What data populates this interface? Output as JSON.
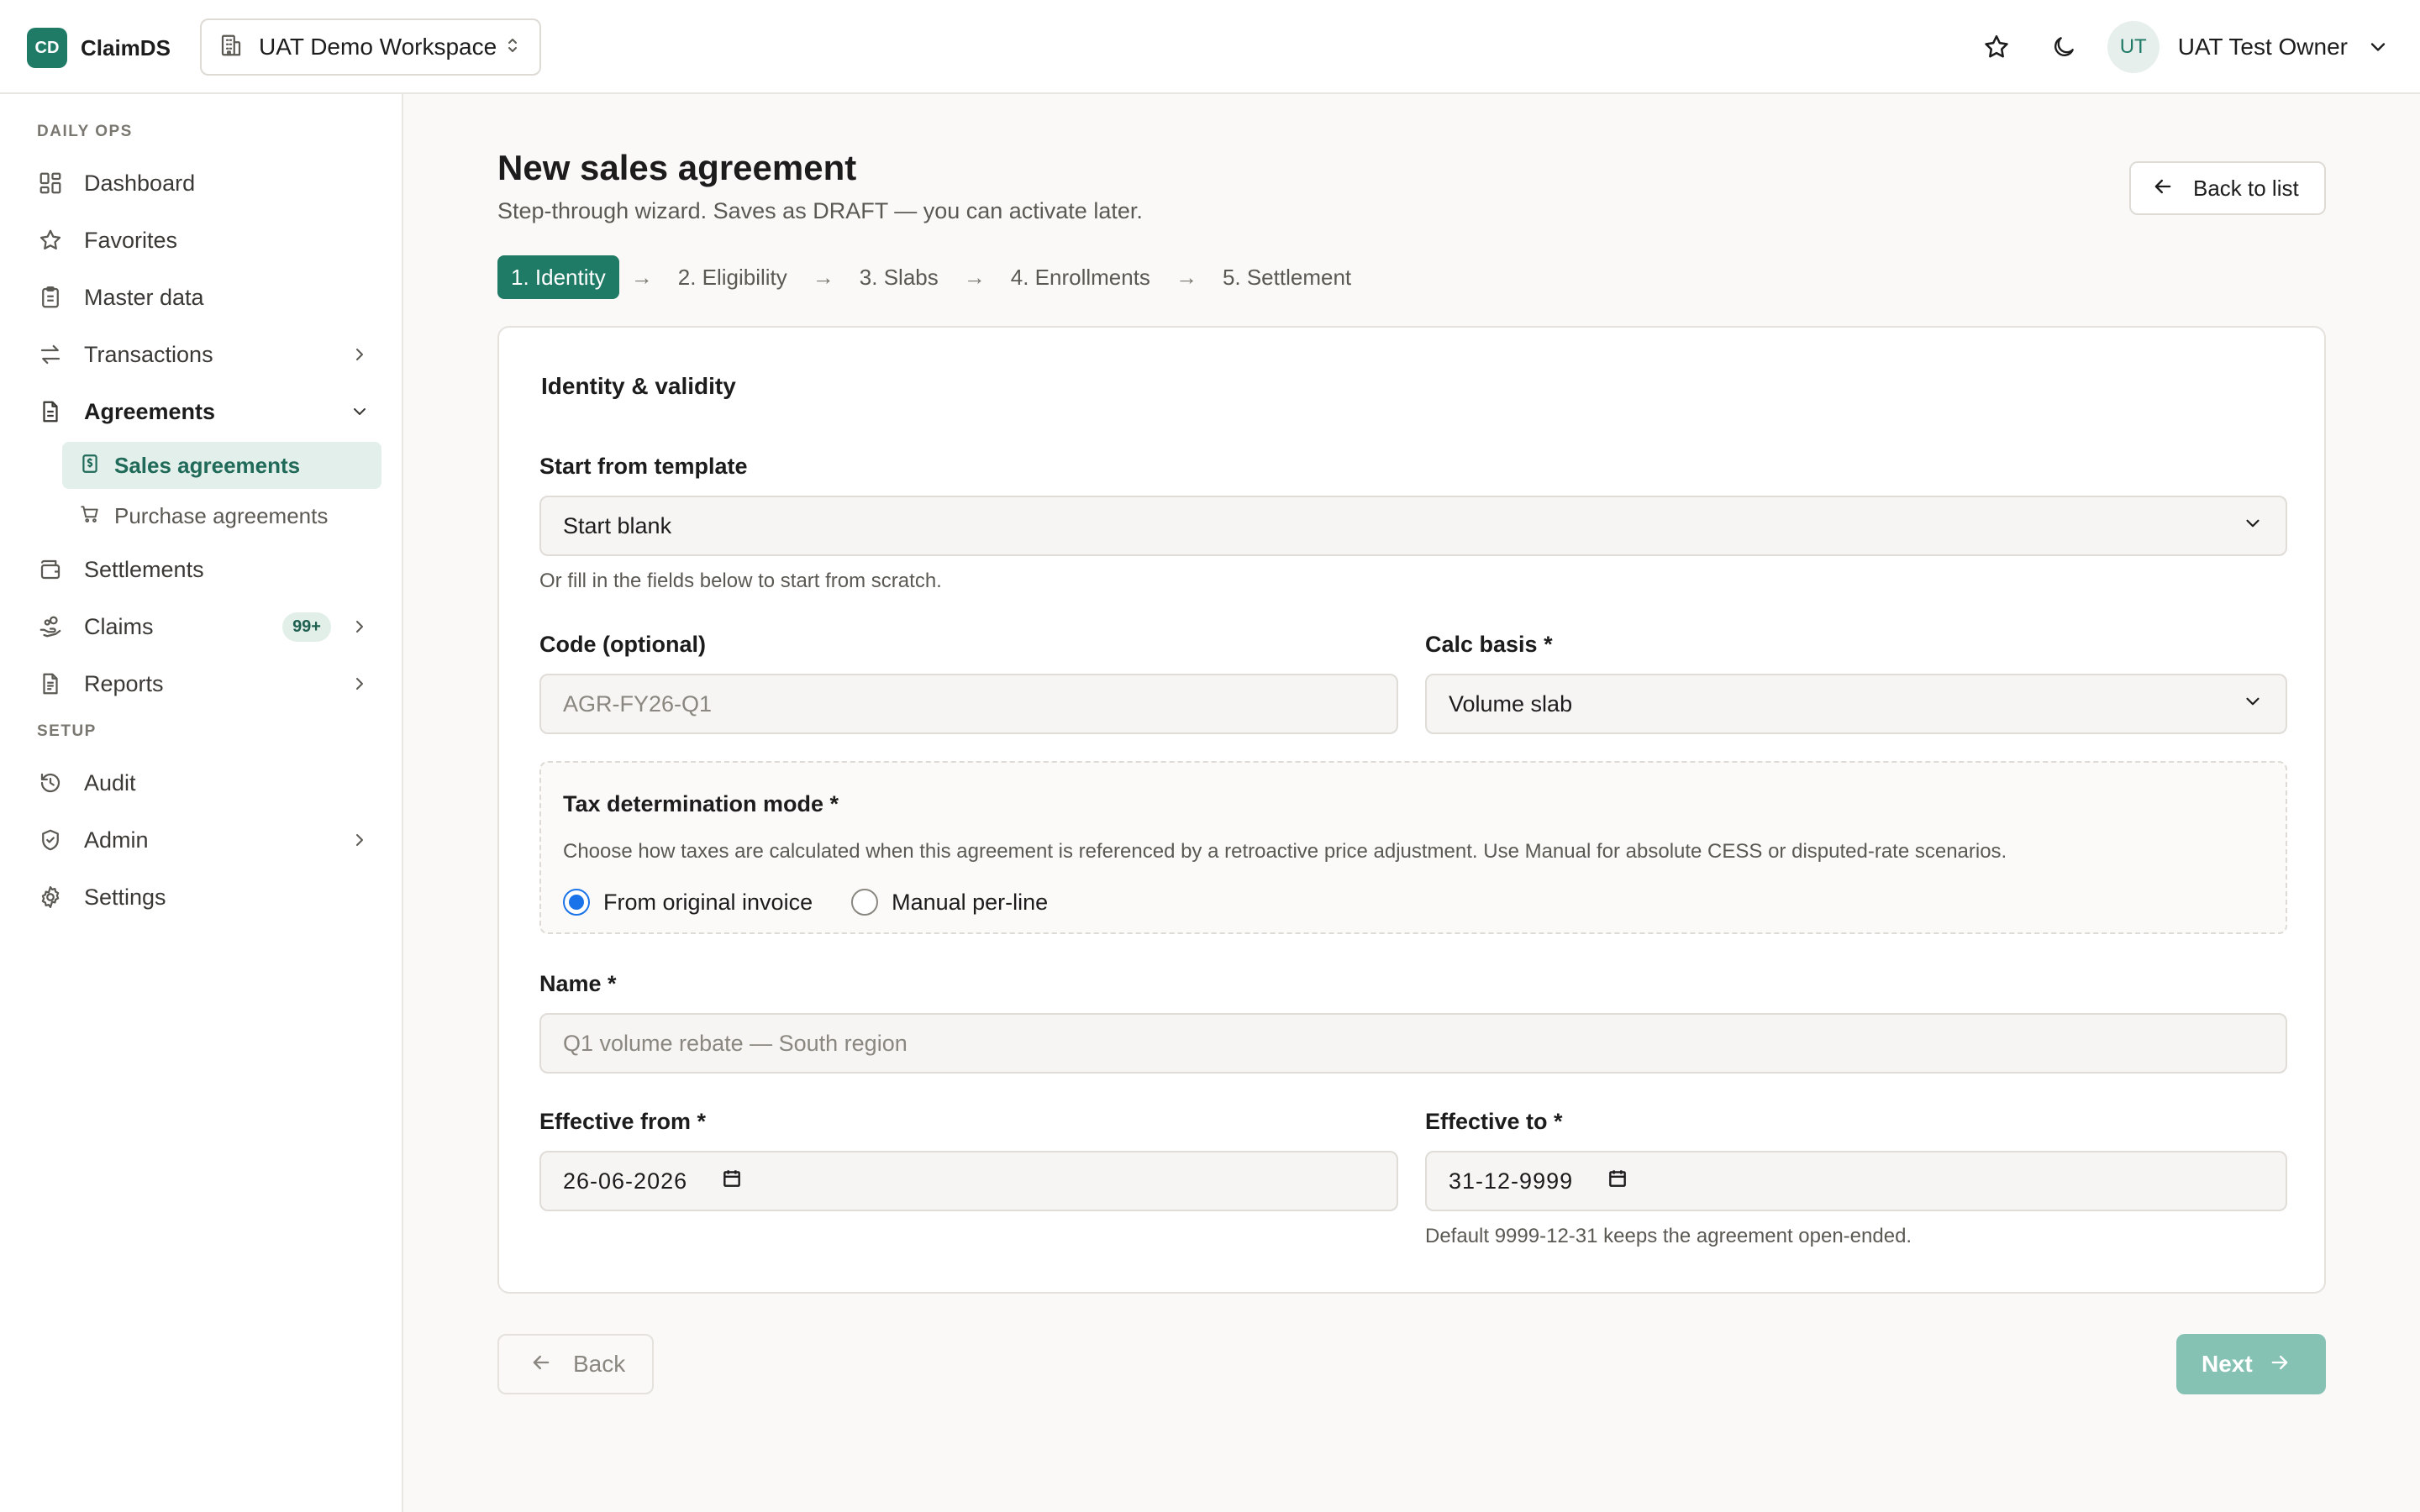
{
  "brand": {
    "logo_text": "CD",
    "name": "ClaimDS"
  },
  "workspace": {
    "label": "UAT Demo Workspace"
  },
  "user": {
    "initials": "UT",
    "name": "UAT Test Owner"
  },
  "sidebar": {
    "section_daily": "DAILY OPS",
    "section_setup": "SETUP",
    "items": {
      "dashboard": "Dashboard",
      "favorites": "Favorites",
      "master_data": "Master data",
      "transactions": "Transactions",
      "agreements": "Agreements",
      "sales_agreements": "Sales agreements",
      "purchase_agreements": "Purchase agreements",
      "settlements": "Settlements",
      "claims": "Claims",
      "claims_badge": "99+",
      "reports": "Reports",
      "audit": "Audit",
      "admin": "Admin",
      "settings": "Settings"
    }
  },
  "page": {
    "title": "New sales agreement",
    "subtitle": "Step-through wizard. Saves as DRAFT — you can activate later.",
    "back_to_list": "Back to list"
  },
  "steps": [
    "1. Identity",
    "2. Eligibility",
    "3. Slabs",
    "4. Enrollments",
    "5. Settlement"
  ],
  "step_arrow": "→",
  "form": {
    "section_title": "Identity & validity",
    "template_label": "Start from template",
    "template_value": "Start blank",
    "template_helper": "Or fill in the fields below to start from scratch.",
    "code_label": "Code (optional)",
    "code_placeholder": "AGR-FY26-Q1",
    "calc_basis_label": "Calc basis *",
    "calc_basis_value": "Volume slab",
    "tax_label": "Tax determination mode *",
    "tax_help": "Choose how taxes are calculated when this agreement is referenced by a retroactive price adjustment. Use Manual for absolute CESS or disputed-rate scenarios.",
    "tax_option_1": "From original invoice",
    "tax_option_2": "Manual per-line",
    "name_label": "Name *",
    "name_placeholder": "Q1 volume rebate — South region",
    "effective_from_label": "Effective from *",
    "effective_from_value": "26-06-2026",
    "effective_to_label": "Effective to *",
    "effective_to_value": "31-12-9999",
    "effective_to_helper": "Default 9999-12-31 keeps the agreement open-ended."
  },
  "footer": {
    "back_label": "Back",
    "next_label": "Next"
  },
  "colors": {
    "accent": "#1f7a66",
    "active_nav_bg": "#e3efea",
    "next_disabled": "#86c2b4",
    "radio": "#1a73e8"
  }
}
